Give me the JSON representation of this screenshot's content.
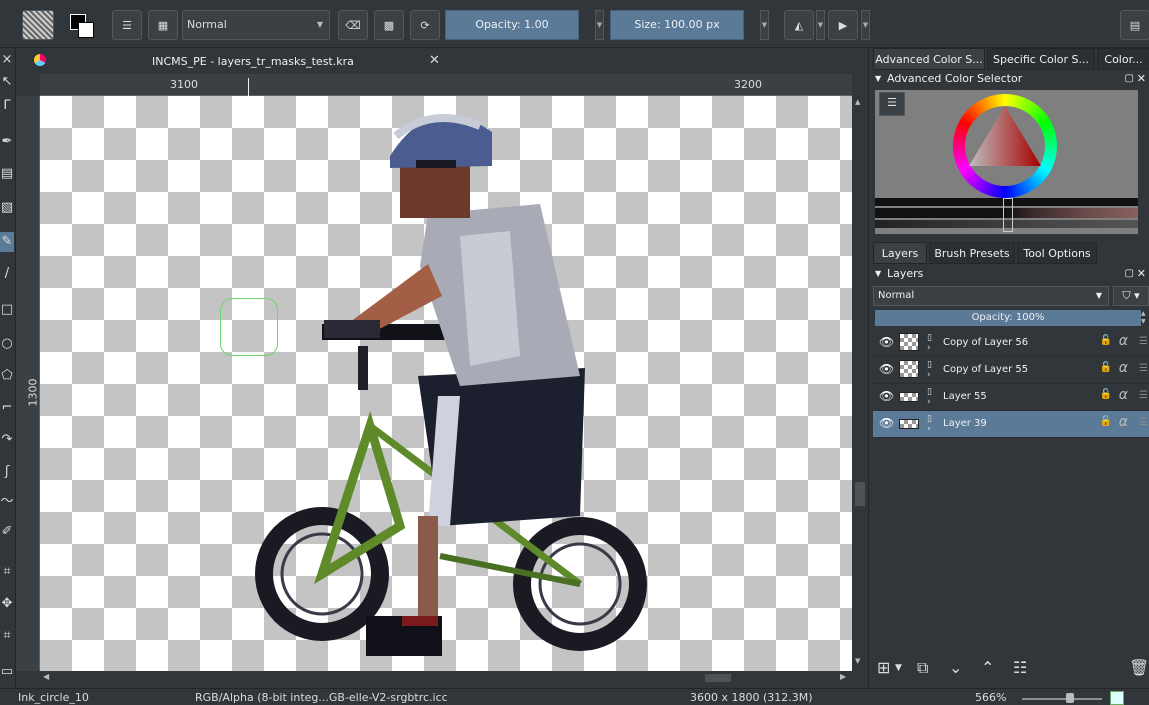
{
  "toolbar": {
    "blend_mode": "Normal",
    "opacity_label": "Opacity:  1.00",
    "size_label": "Size:  100.00 px"
  },
  "document": {
    "tab_title": "INCMS_PE - layers_tr_masks_test.kra"
  },
  "rulers": {
    "h_labels": [
      "3100",
      "3200"
    ],
    "v_labels": [
      "1300"
    ]
  },
  "docker": {
    "color_tabs": [
      "Advanced Color S...",
      "Specific Color S...",
      "Color..."
    ],
    "color_header": "Advanced Color Selector",
    "layer_tabs": [
      "Layers",
      "Brush Presets",
      "Tool Options"
    ],
    "layers_header": "Layers",
    "blend_mode": "Normal",
    "opacity_label": "Opacity:  100%",
    "layers": [
      {
        "name": "Copy of Layer 56",
        "selected": false
      },
      {
        "name": "Copy of Layer 55",
        "selected": false
      },
      {
        "name": "Layer 55",
        "selected": false
      },
      {
        "name": "Layer 39",
        "selected": true
      }
    ]
  },
  "status": {
    "brush": "Ink_circle_10",
    "color_space": "RGB/Alpha (8-bit integ...GB-elle-V2-srgbtrc.icc",
    "dimensions": "3600 x 1800 (312.3M)",
    "zoom": "566%"
  },
  "colors": {
    "accent": "#5b7a98",
    "background": "#31363b",
    "checker_dark": "#c4c4c4"
  }
}
